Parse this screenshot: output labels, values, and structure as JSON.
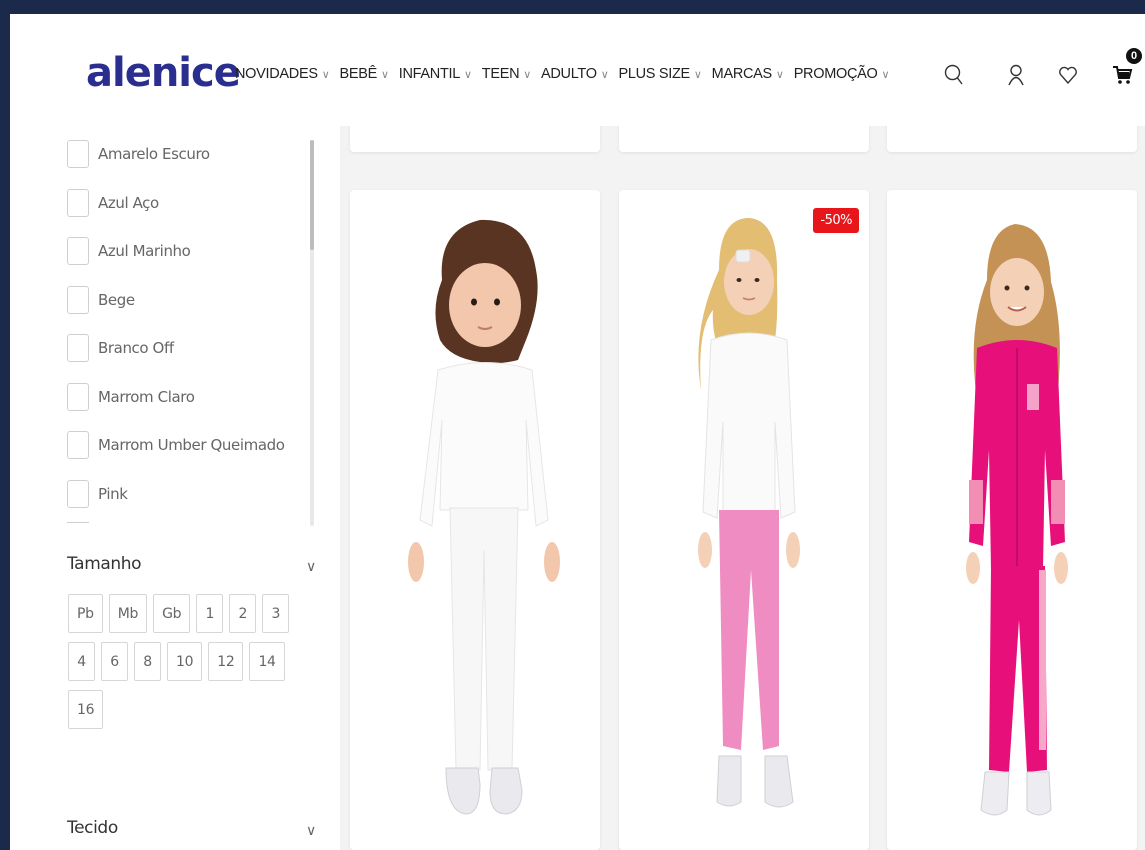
{
  "brand": {
    "logo_text": "alenice",
    "logo_color": "#2a2f8f"
  },
  "nav": {
    "items": [
      {
        "label": "NOVIDADES"
      },
      {
        "label": "BEBÊ"
      },
      {
        "label": "INFANTIL"
      },
      {
        "label": "TEEN"
      },
      {
        "label": "ADULTO"
      },
      {
        "label": "PLUS SIZE"
      },
      {
        "label": "MARCAS"
      },
      {
        "label": "PROMOÇÃO"
      }
    ],
    "chevron": "∨"
  },
  "header_icons": {
    "search": "search-icon",
    "account": "user-icon",
    "wishlist": "heart-icon",
    "cart": "cart-icon",
    "cart_count": "0"
  },
  "filters": {
    "colors": [
      "Amarelo Escuro",
      "Azul Aço",
      "Azul Marinho",
      "Bege",
      "Branco Off",
      "Marrom Claro",
      "Marrom Umber Queimado",
      "Pink"
    ],
    "size_section": {
      "title": "Tamanho",
      "chevron": "∨",
      "rows": [
        [
          "Pb",
          "Mb",
          "Gb",
          "1",
          "2",
          "3"
        ],
        [
          "4",
          "6",
          "8",
          "10",
          "12",
          "14"
        ],
        [
          "16"
        ]
      ]
    },
    "fabric_section": {
      "title": "Tecido",
      "chevron": "∨"
    }
  },
  "products": [
    {
      "image": "baby-white-outfit",
      "discount": ""
    },
    {
      "image": "girl-white-top-pink-pants",
      "discount": "-50%"
    },
    {
      "image": "girl-pink-tracksuit",
      "discount": ""
    }
  ],
  "colors": {
    "discount_badge": "#e8161b",
    "page_bg": "#f3f3f4"
  }
}
